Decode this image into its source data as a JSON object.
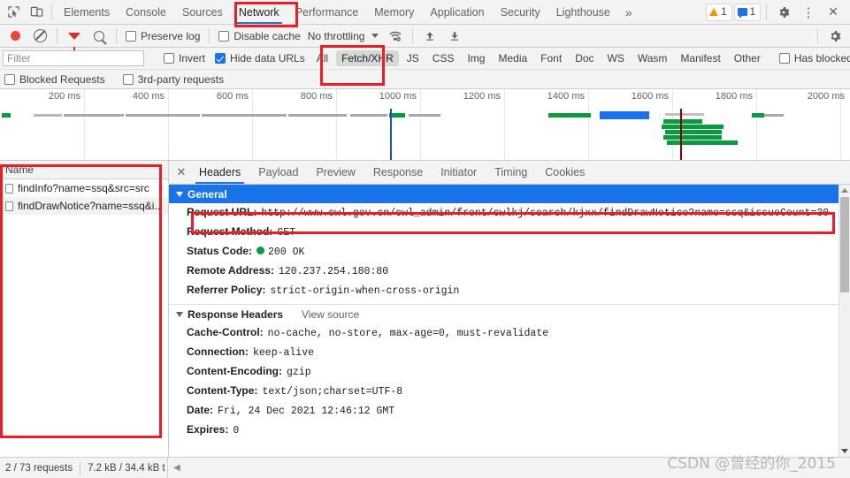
{
  "tabbar": {
    "icons": [
      {
        "name": "inspect-element-icon"
      },
      {
        "name": "device-toolbar-icon"
      }
    ],
    "tabs": [
      {
        "label": "Elements",
        "selected": false
      },
      {
        "label": "Console",
        "selected": false
      },
      {
        "label": "Sources",
        "selected": false
      },
      {
        "label": "Network",
        "selected": true
      },
      {
        "label": "Performance",
        "selected": false
      },
      {
        "label": "Memory",
        "selected": false
      },
      {
        "label": "Application",
        "selected": false
      },
      {
        "label": "Security",
        "selected": false
      },
      {
        "label": "Lighthouse",
        "selected": false
      }
    ],
    "more_label": "»",
    "warning_count": "1",
    "message_count": "1",
    "settings_label": "⚙",
    "kebab_label": "⋮",
    "close_label": "✕"
  },
  "network_toolbar": {
    "record_tooltip": "Record",
    "clear_tooltip": "Clear",
    "filter_tooltip": "Filter",
    "search_tooltip": "Search",
    "preserve_log_label": "Preserve log",
    "preserve_log_checked": false,
    "disable_cache_label": "Disable cache",
    "disable_cache_checked": false,
    "throttling_label": "No throttling",
    "import_har_tooltip": "Import HAR",
    "export_har_tooltip": "Export HAR",
    "settings_tooltip": "Network settings"
  },
  "filter_bar": {
    "filter_placeholder": "Filter",
    "filter_value": "",
    "invert_label": "Invert",
    "invert_checked": false,
    "hide_data_urls_label": "Hide data URLs",
    "hide_data_urls_checked": true,
    "types": [
      {
        "label": "All",
        "active": false
      },
      {
        "label": "Fetch/XHR",
        "active": true
      },
      {
        "label": "JS",
        "active": false
      },
      {
        "label": "CSS",
        "active": false
      },
      {
        "label": "Img",
        "active": false
      },
      {
        "label": "Media",
        "active": false
      },
      {
        "label": "Font",
        "active": false
      },
      {
        "label": "Doc",
        "active": false
      },
      {
        "label": "WS",
        "active": false
      },
      {
        "label": "Wasm",
        "active": false
      },
      {
        "label": "Manifest",
        "active": false
      },
      {
        "label": "Other",
        "active": false
      }
    ],
    "has_blocked_cookies_label": "Has blocked cookies",
    "has_blocked_cookies_checked": false
  },
  "blocked_bar": {
    "blocked_requests_label": "Blocked Requests",
    "blocked_requests_checked": false,
    "third_party_label": "3rd-party requests",
    "third_party_checked": false
  },
  "overview": {
    "ticks": [
      "200 ms",
      "400 ms",
      "600 ms",
      "800 ms",
      "1000 ms",
      "1200 ms",
      "1400 ms",
      "1600 ms",
      "1800 ms",
      "2000 ms"
    ]
  },
  "requests_panel": {
    "column_header": "Name",
    "rows": [
      {
        "name": "findInfo?name=ssq&src=src",
        "icon": "document-icon"
      },
      {
        "name": "findDrawNotice?name=ssq&i..",
        "icon": "document-icon"
      }
    ]
  },
  "detail_panel": {
    "close_label": "✕",
    "tabs": [
      {
        "label": "Headers",
        "selected": true
      },
      {
        "label": "Payload",
        "selected": false
      },
      {
        "label": "Preview",
        "selected": false
      },
      {
        "label": "Response",
        "selected": false
      },
      {
        "label": "Initiator",
        "selected": false
      },
      {
        "label": "Timing",
        "selected": false
      },
      {
        "label": "Cookies",
        "selected": false
      }
    ],
    "general": {
      "title": "General",
      "rows": [
        {
          "key": "Request URL:",
          "value": "http://www.cwl.gov.cn/cwl_admin/front/cwlkj/search/kjxx/findDrawNotice?name=ssq&issueCount=30"
        },
        {
          "key": "Request Method:",
          "value": "GET"
        },
        {
          "key": "Status Code:",
          "value": "200 OK",
          "status_dot": true
        },
        {
          "key": "Remote Address:",
          "value": "120.237.254.180:80"
        },
        {
          "key": "Referrer Policy:",
          "value": "strict-origin-when-cross-origin"
        }
      ]
    },
    "response_headers": {
      "title": "Response Headers",
      "view_source_label": "View source",
      "rows": [
        {
          "key": "Cache-Control:",
          "value": "no-cache, no-store, max-age=0, must-revalidate"
        },
        {
          "key": "Connection:",
          "value": "keep-alive"
        },
        {
          "key": "Content-Encoding:",
          "value": "gzip"
        },
        {
          "key": "Content-Type:",
          "value": "text/json;charset=UTF-8"
        },
        {
          "key": "Date:",
          "value": "Fri, 24 Dec 2021 12:46:12 GMT"
        },
        {
          "key": "Expires:",
          "value": "0"
        }
      ]
    }
  },
  "status_bar": {
    "requests_text": "2 / 73 requests",
    "transfer_text": "7.2 kB / 34.4 kB t"
  },
  "watermark": "CSDN @曾经的你_2015",
  "colors": {
    "accent": "#1a73e8",
    "annotation": "#ee1c25",
    "record": "#e8453c",
    "status_ok": "#0a9b3f",
    "toolbar_bg": "#f3f3f3"
  }
}
